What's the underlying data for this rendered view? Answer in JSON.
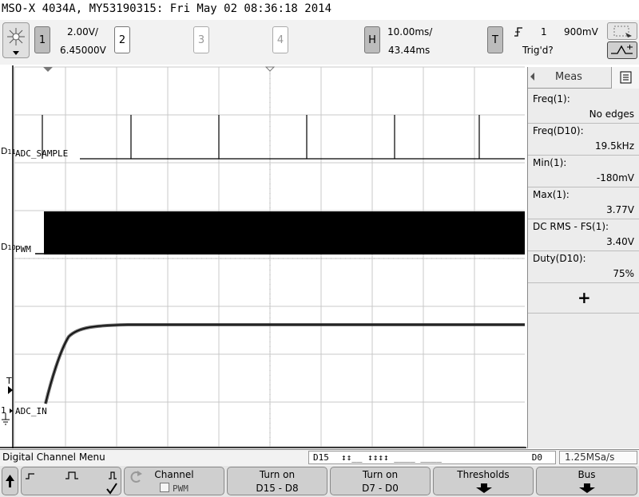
{
  "title": "MSO-X 4034A, MY53190315: Fri May 02 08:36:18 2014",
  "channels": {
    "ch1": {
      "number": "1",
      "scale": "2.00V/",
      "offset": "6.45000V"
    },
    "ch2": {
      "number": "2"
    },
    "ch3": {
      "number": "3"
    },
    "ch4": {
      "number": "4"
    }
  },
  "horizontal": {
    "key": "H",
    "scale": "10.00ms/",
    "delay": "43.44ms"
  },
  "trigger": {
    "key": "T",
    "source": "1",
    "level": "900mV",
    "status": "Trig'd?",
    "slope_icon": "rising-edge-icon"
  },
  "labels": {
    "d11_prefix": "D",
    "d11_sub": "11",
    "d11_name": "ADC_SAMPLE",
    "d10_prefix": "D",
    "d10_sub": "10",
    "d10_name": "PWM",
    "ch1_prefix": "1",
    "ch1_name": "ADC_IN",
    "trigger_marker": "T"
  },
  "meas": {
    "tab_label": "Meas",
    "items": [
      {
        "name": "Freq(1):",
        "value": "No edges"
      },
      {
        "name": "Freq(D10):",
        "value": "19.5kHz"
      },
      {
        "name": "Min(1):",
        "value": "-180mV"
      },
      {
        "name": "Max(1):",
        "value": "3.77V"
      },
      {
        "name": "DC RMS - FS(1):",
        "value": "3.40V"
      },
      {
        "name": "Duty(D10):",
        "value": "75%"
      }
    ],
    "add_label": "+"
  },
  "status": {
    "menu_title": "Digital Channel Menu",
    "bus_start": "D15",
    "bus_symbols": "↕↕__ ↕↕↕↕ ____ ____",
    "bus_end": "D0",
    "sample_rate": "1.25MSa/s"
  },
  "softkeys": {
    "channel_title": "Channel",
    "channel_value": "PWM",
    "turnon1_title": "Turn on",
    "turnon1_value": "D15 - D8",
    "turnon2_title": "Turn on",
    "turnon2_value": "D7 - D0",
    "thresholds_title": "Thresholds",
    "bus_title": "Bus"
  },
  "colors": {
    "background": "#ffffff",
    "grid": "#c8c8c8",
    "trace": "#000000",
    "panel": "#ececec"
  }
}
